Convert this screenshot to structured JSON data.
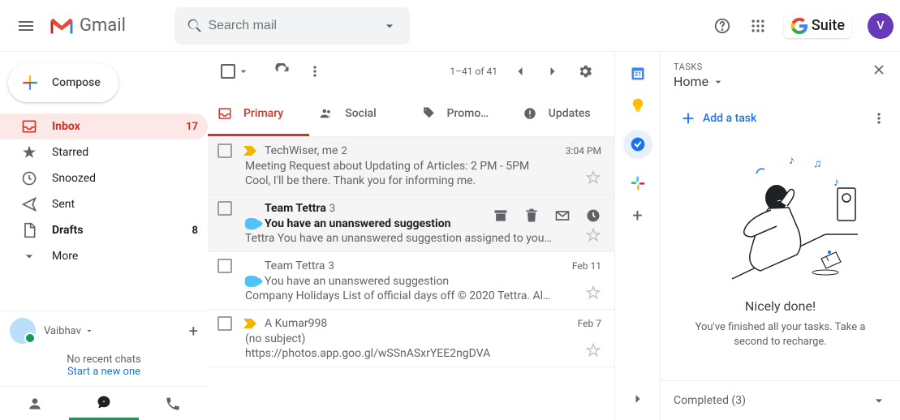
{
  "header": {
    "logo_text": "Gmail",
    "search_placeholder": "Search mail",
    "gsuite_text": "Suite",
    "avatar_letter": "V"
  },
  "compose_label": "Compose",
  "nav": {
    "inbox": {
      "label": "Inbox",
      "count": "17"
    },
    "starred": {
      "label": "Starred"
    },
    "snoozed": {
      "label": "Snoozed"
    },
    "sent": {
      "label": "Sent"
    },
    "drafts": {
      "label": "Drafts",
      "count": "8"
    },
    "more": {
      "label": "More"
    }
  },
  "hangouts": {
    "user": "Vaibhav",
    "no_chats": "No recent chats",
    "start": "Start a new one"
  },
  "toolbar": {
    "pagination": "1–41 of 41"
  },
  "tabs": {
    "primary": "Primary",
    "social": "Social",
    "promotions": "Promo…",
    "updates": "Updates"
  },
  "emails": {
    "0": {
      "sender": "TechWiser, me",
      "thread": "2",
      "date": "3:04 PM",
      "subject": "Meeting Request about Updating of Articles: 2 PM - 5PM",
      "snippet": "Cool, I'll be there. Thank you for informing me."
    },
    "1": {
      "sender": "Team Tettra",
      "thread": "3",
      "date": "",
      "subject": "You have an unanswered suggestion",
      "snippet": "Tettra You have an unanswered suggestion assigned to you…"
    },
    "2": {
      "sender": "Team Tettra",
      "thread": "3",
      "date": "Feb 11",
      "subject": "You have an unanswered suggestion",
      "snippet": "Company Holidays List of official days off © 2020 Tettra. Al…"
    },
    "3": {
      "sender": "A Kumar998",
      "thread": "",
      "date": "Feb 7",
      "subject": "(no subject)",
      "snippet": "https://photos.app.goo.gl/wSSnASxrYEE2ngDVA"
    }
  },
  "tasks": {
    "label": "TASKS",
    "list_name": "Home",
    "add_label": "Add a task",
    "done_title": "Nicely done!",
    "done_sub": "You've finished all your tasks. Take a second to recharge.",
    "completed": "Completed (3)"
  }
}
